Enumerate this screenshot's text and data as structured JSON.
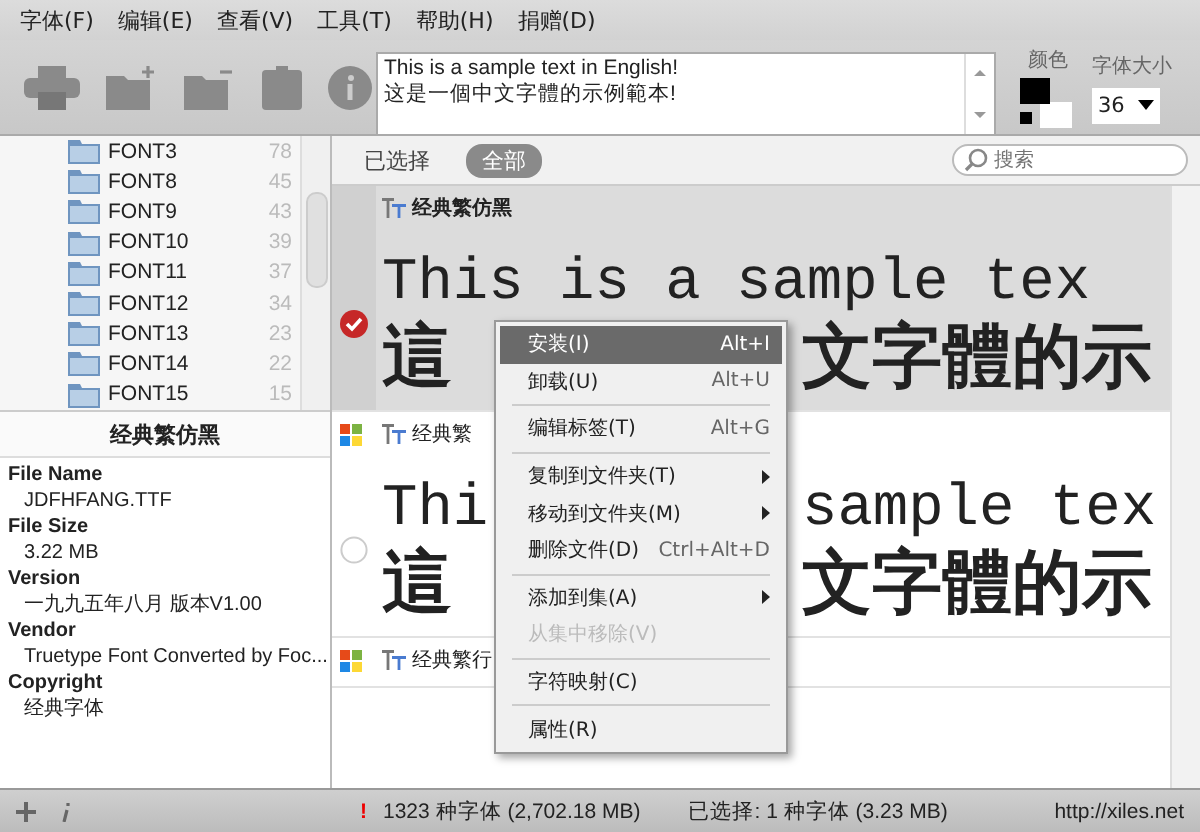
{
  "menubar": [
    {
      "label": "字体(F)"
    },
    {
      "label": "编辑(E)"
    },
    {
      "label": "查看(V)"
    },
    {
      "label": "工具(T)"
    },
    {
      "label": "帮助(H)"
    },
    {
      "label": "捐赠(D)"
    }
  ],
  "toolbar": {
    "sample_text": "This is a sample text in English!\n这是一個中文字體的示例範本!",
    "color_label": "颜色",
    "size_label": "字体大小",
    "size_value": "36"
  },
  "folders": [
    {
      "name": "FONT3",
      "count": "78"
    },
    {
      "name": "FONT8",
      "count": "45"
    },
    {
      "name": "FONT9",
      "count": "43"
    },
    {
      "name": "FONT10",
      "count": "39"
    },
    {
      "name": "FONT11",
      "count": "37"
    },
    {
      "name": "FONT12",
      "count": "34"
    },
    {
      "name": "FONT13",
      "count": "23"
    },
    {
      "name": "FONT14",
      "count": "22"
    },
    {
      "name": "FONT15",
      "count": "15"
    }
  ],
  "info": {
    "title": "经典繁仿黑",
    "fields": [
      {
        "label": "File Name",
        "value": "JDFHFANG.TTF"
      },
      {
        "label": "File Size",
        "value": "3.22 MB"
      },
      {
        "label": "Version",
        "value": "一九九五年八月 版本V1.00"
      },
      {
        "label": "Vendor",
        "value": "Truetype Font Converted by Foc..."
      },
      {
        "label": "Copyright",
        "value": "经典字体"
      }
    ]
  },
  "filters": [
    {
      "label": "已选择",
      "selected": false
    },
    {
      "label": "全部",
      "selected": true
    }
  ],
  "search": {
    "placeholder": "搜索"
  },
  "fonts": [
    {
      "name": "经典繁仿黑",
      "selected": true,
      "installed": false,
      "preview_en": [
        "This is a sample tex"
      ],
      "preview_cn": [
        "這",
        "文字體的示"
      ]
    },
    {
      "name": "经典繁",
      "selected": false,
      "installed": true,
      "preview_en": [
        "Thi",
        "sample tex"
      ],
      "preview_cn": [
        "這",
        "文字體的示"
      ]
    },
    {
      "name": "经典繁行",
      "selected": false,
      "installed": true
    }
  ],
  "context_menu": [
    {
      "kind": "item",
      "label": "安装(I)",
      "shortcut": "Alt+I",
      "selected": true,
      "disabled": false,
      "submenu": false
    },
    {
      "kind": "item",
      "label": "卸载(U)",
      "shortcut": "Alt+U",
      "selected": false,
      "disabled": false,
      "submenu": false
    },
    {
      "kind": "separator"
    },
    {
      "kind": "item",
      "label": "编辑标签(T)",
      "shortcut": "Alt+G",
      "selected": false,
      "disabled": false,
      "submenu": false
    },
    {
      "kind": "separator"
    },
    {
      "kind": "item",
      "label": "复制到文件夹(T)",
      "selected": false,
      "disabled": false,
      "submenu": true
    },
    {
      "kind": "item",
      "label": "移动到文件夹(M)",
      "selected": false,
      "disabled": false,
      "submenu": true
    },
    {
      "kind": "item",
      "label": "删除文件(D)",
      "shortcut": "Ctrl+Alt+D",
      "selected": false,
      "disabled": false,
      "submenu": false
    },
    {
      "kind": "separator"
    },
    {
      "kind": "item",
      "label": "添加到集(A)",
      "selected": false,
      "disabled": false,
      "submenu": true
    },
    {
      "kind": "item",
      "label": "从集中移除(V)",
      "selected": false,
      "disabled": true,
      "submenu": false
    },
    {
      "kind": "separator"
    },
    {
      "kind": "item",
      "label": "字符映射(C)",
      "selected": false,
      "disabled": false,
      "submenu": false
    },
    {
      "kind": "separator"
    },
    {
      "kind": "item",
      "label": "属性(R)",
      "selected": false,
      "disabled": false,
      "submenu": false
    }
  ],
  "status_bar": {
    "warning": "!",
    "total": "1323 种字体 (2,702.18 MB)",
    "selected": "已选择: 1 种字体 (3.23 MB)",
    "link": "http://xiles.net"
  }
}
